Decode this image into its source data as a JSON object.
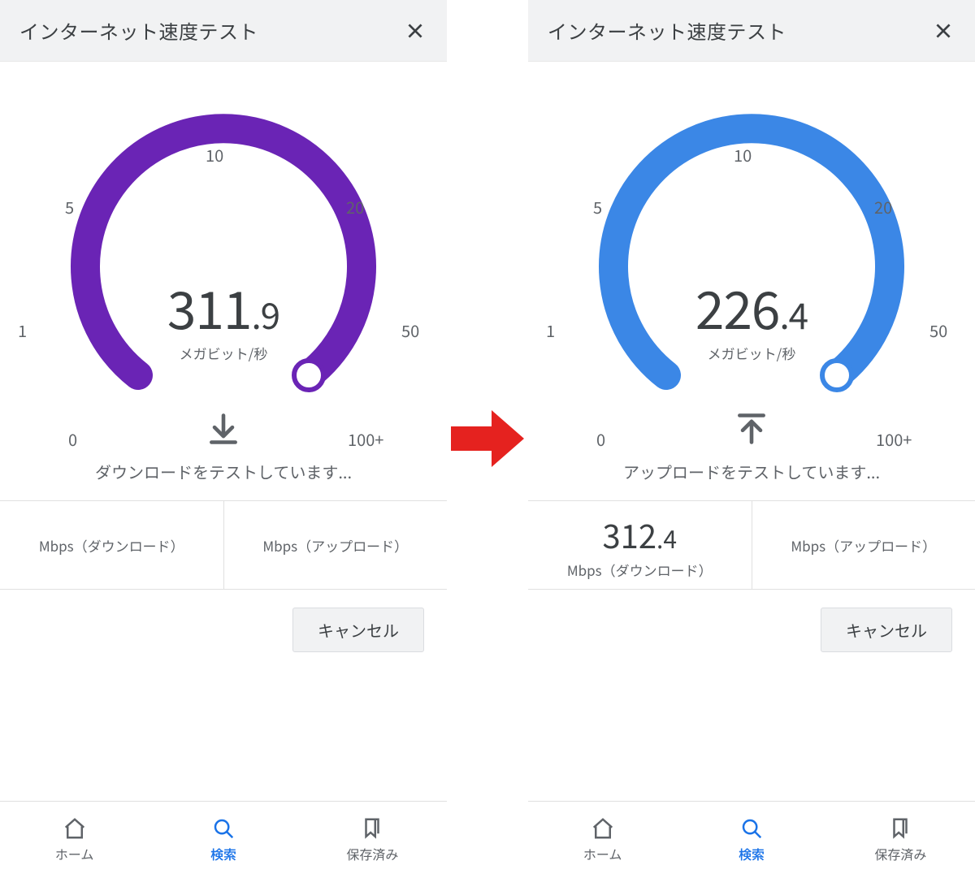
{
  "header": {
    "title": "インターネット速度テスト"
  },
  "ticks": {
    "t0": "0",
    "t1": "1",
    "t5": "5",
    "t10": "10",
    "t20": "20",
    "t50": "50",
    "t100": "100+"
  },
  "left": {
    "color": "#6a24b5",
    "value_int": "311",
    "value_frac": ".9",
    "unit": "メガビット/秒",
    "status": "ダウンロードをテストしています...",
    "results": {
      "dl_value": "",
      "dl_label": "Mbps（ダウンロード）",
      "ul_value": "",
      "ul_label": "Mbps（アップロード）"
    },
    "cancel": "キャンセル"
  },
  "right": {
    "color": "#3b87e6",
    "value_int": "226",
    "value_frac": ".4",
    "unit": "メガビット/秒",
    "status": "アップロードをテストしています...",
    "results": {
      "dl_value_int": "312",
      "dl_value_frac": ".4",
      "dl_label": "Mbps（ダウンロード）",
      "ul_value": "",
      "ul_label": "Mbps（アップロード）"
    },
    "cancel": "キャンセル"
  },
  "nav": {
    "home": "ホーム",
    "search": "検索",
    "saved": "保存済み"
  }
}
